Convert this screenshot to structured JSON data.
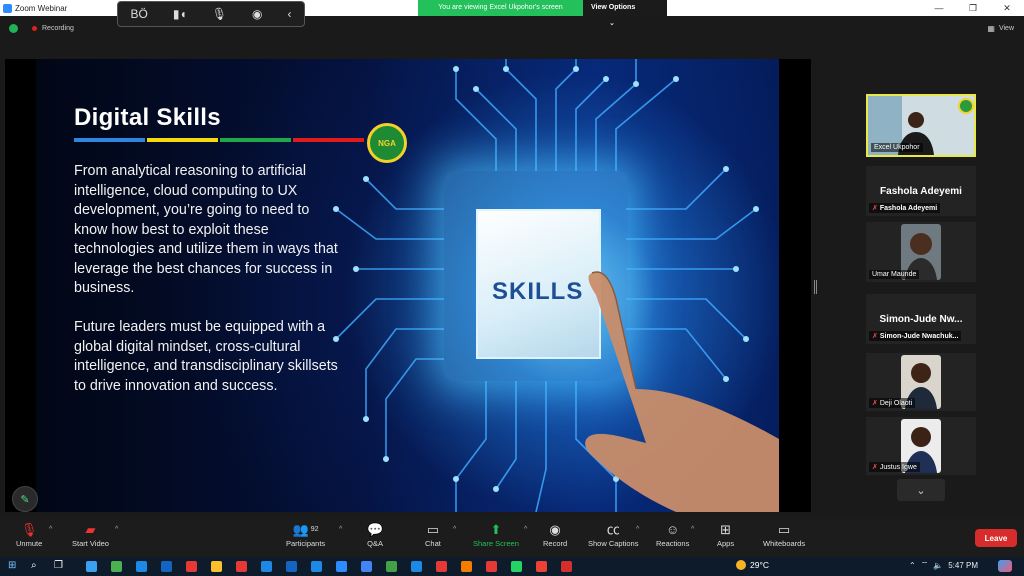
{
  "window": {
    "title": "Zoom Webinar",
    "minimize": "—",
    "restore": "❐",
    "close": "✕"
  },
  "float_toolbar": {
    "icons": [
      "bo-icon",
      "audio-bars-icon",
      "microphone-icon",
      "signal-icon",
      "chevron-left-icon"
    ],
    "glyphs": [
      "BÖ",
      "▮◖",
      "🎙",
      "◉",
      "‹"
    ]
  },
  "banner": {
    "viewing_text": "You are viewing Excel Ukpohor's screen",
    "view_options_label": "View Options",
    "caret": "⌄"
  },
  "status": {
    "recording_label": "Recording",
    "view_label": "View"
  },
  "slide": {
    "title": "Digital Skills",
    "bar_colors": [
      "#2e86de",
      "#f5d90a",
      "#1fa84a",
      "#e01b1b"
    ],
    "logo_text": "NGA",
    "paragraph1": "From analytical reasoning to artificial intelligence, cloud computing to UX development, you’re going to need to know how best to exploit these technologies and utilize them in ways that leverage the best chances for success in business.",
    "paragraph2": "Future leaders must be equipped with a global digital mindset, cross-cultural intelligence, and transdisciplinary skillsets to drive innovation and success.",
    "chip_text": "SKILLS"
  },
  "participants": [
    {
      "name": "Excel Ukpohor",
      "video": true,
      "muted": false
    },
    {
      "name": "Fashola Adeyemi",
      "display_name": "Fashola Adeyemi",
      "video": false,
      "muted": true
    },
    {
      "name": "Umar Maunde",
      "video": true,
      "muted": false
    },
    {
      "name": "Simon-Jude Nwachuk...",
      "display_name": "Simon-Jude Nw...",
      "video": false,
      "muted": true
    },
    {
      "name": "Deji Olaoti",
      "video": true,
      "muted": true
    },
    {
      "name": "Justus Igwe",
      "video": true,
      "muted": true
    }
  ],
  "toolbar": {
    "unmute": "Unmute",
    "start_video": "Start Video",
    "participants": "Participants",
    "participants_count": "92",
    "qa": "Q&A",
    "chat": "Chat",
    "share_screen": "Share Screen",
    "record": "Record",
    "show_captions": "Show Captions",
    "reactions": "Reactions",
    "apps": "Apps",
    "whiteboards": "Whiteboards",
    "leave": "Leave",
    "caret": "^"
  },
  "taskbar": {
    "temperature": "29°C",
    "time": "5:47 PM",
    "app_colors": [
      "#3aa0f0",
      "#4caf50",
      "#1e88e5",
      "#1565c0",
      "#e53935",
      "#fbc02d",
      "#e53935",
      "#1e88e5",
      "#1565c0",
      "#1e88e5",
      "#2d8cff",
      "#4285f4",
      "#43a047",
      "#1e88e5",
      "#e53935",
      "#f57c00",
      "#e53935",
      "#25d366",
      "#ea4335",
      "#d32f2f"
    ]
  },
  "colors": {
    "accent_green": "#23c05b",
    "leave_red": "#d72c2c",
    "active_speaker": "#e8e84a"
  }
}
